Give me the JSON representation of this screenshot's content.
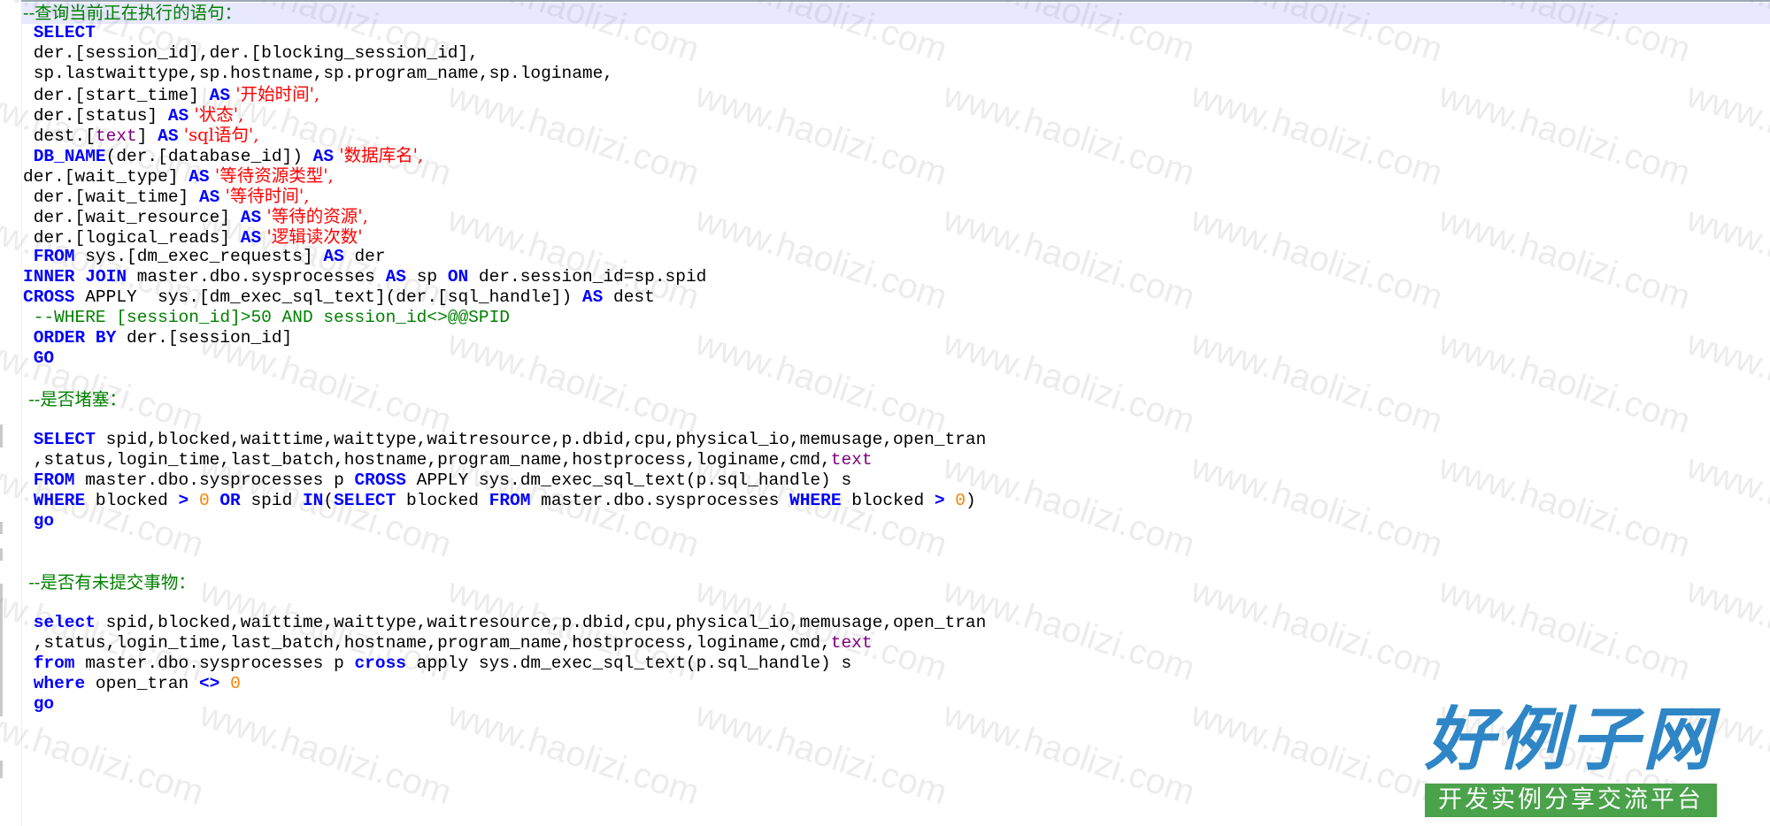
{
  "editor": {
    "lines": [
      {
        "tokens": [
          {
            "t": "--查询当前正在执行的语句：",
            "c": "cm"
          }
        ]
      },
      {
        "tokens": [
          {
            "t": " SELECT",
            "c": "kw"
          }
        ]
      },
      {
        "tokens": [
          {
            "t": " der.[session_id],der.[blocking_session_id],",
            "c": "id"
          }
        ]
      },
      {
        "tokens": [
          {
            "t": " sp.lastwaittype,sp.hostname,sp.program_name,sp.loginame,",
            "c": "id"
          }
        ]
      },
      {
        "tokens": [
          {
            "t": " der.[start_time] ",
            "c": "id"
          },
          {
            "t": "AS",
            "c": "kw"
          },
          {
            "t": " '开始时间',",
            "c": "st"
          }
        ]
      },
      {
        "tokens": [
          {
            "t": " der.[status] ",
            "c": "id"
          },
          {
            "t": "AS",
            "c": "kw"
          },
          {
            "t": " '状态',",
            "c": "st"
          }
        ]
      },
      {
        "tokens": [
          {
            "t": " dest.[",
            "c": "id"
          },
          {
            "t": "text",
            "c": "ob"
          },
          {
            "t": "] ",
            "c": "id"
          },
          {
            "t": "AS",
            "c": "kw"
          },
          {
            "t": " 'sql语句',",
            "c": "st"
          }
        ]
      },
      {
        "tokens": [
          {
            "t": " DB_NAME",
            "c": "fn"
          },
          {
            "t": "(der.[database_id]) ",
            "c": "id"
          },
          {
            "t": "AS",
            "c": "kw"
          },
          {
            "t": " '数据库名',",
            "c": "st"
          }
        ]
      },
      {
        "tokens": [
          {
            "t": "der.[wait_type] ",
            "c": "id"
          },
          {
            "t": "AS",
            "c": "kw"
          },
          {
            "t": " '等待资源类型',",
            "c": "st"
          }
        ]
      },
      {
        "tokens": [
          {
            "t": " der.[wait_time] ",
            "c": "id"
          },
          {
            "t": "AS",
            "c": "kw"
          },
          {
            "t": " '等待时间',",
            "c": "st"
          }
        ]
      },
      {
        "tokens": [
          {
            "t": " der.[wait_resource] ",
            "c": "id"
          },
          {
            "t": "AS",
            "c": "kw"
          },
          {
            "t": " '等待的资源',",
            "c": "st"
          }
        ]
      },
      {
        "tokens": [
          {
            "t": " der.[logical_reads] ",
            "c": "id"
          },
          {
            "t": "AS",
            "c": "kw"
          },
          {
            "t": " '逻辑读次数'",
            "c": "st"
          }
        ]
      },
      {
        "tokens": [
          {
            "t": " FROM",
            "c": "kw"
          },
          {
            "t": " sys.[dm_exec_requests] ",
            "c": "id"
          },
          {
            "t": "AS",
            "c": "kw"
          },
          {
            "t": " der",
            "c": "id"
          }
        ]
      },
      {
        "tokens": [
          {
            "t": "INNER JOIN",
            "c": "kw"
          },
          {
            "t": " master.dbo.sysprocesses ",
            "c": "id"
          },
          {
            "t": "AS",
            "c": "kw"
          },
          {
            "t": " sp ",
            "c": "id"
          },
          {
            "t": "ON",
            "c": "kw"
          },
          {
            "t": " der.session_id=sp.spid",
            "c": "id"
          }
        ]
      },
      {
        "tokens": [
          {
            "t": "CROSS",
            "c": "kw"
          },
          {
            "t": " APPLY  sys.[dm_exec_sql_text](der.[sql_handle]) ",
            "c": "id"
          },
          {
            "t": "AS",
            "c": "kw"
          },
          {
            "t": " dest",
            "c": "id"
          }
        ]
      },
      {
        "tokens": [
          {
            "t": " --WHERE [session_id]>50 AND session_id<>@@SPID",
            "c": "cm"
          }
        ]
      },
      {
        "tokens": [
          {
            "t": " ORDER BY",
            "c": "kw"
          },
          {
            "t": " der.[session_id]",
            "c": "id"
          }
        ]
      },
      {
        "tokens": [
          {
            "t": " GO",
            "c": "kw"
          }
        ]
      },
      {
        "tokens": []
      },
      {
        "tokens": [
          {
            "t": " --是否堵塞：",
            "c": "cm"
          }
        ]
      },
      {
        "tokens": []
      },
      {
        "tokens": [
          {
            "t": " SELECT",
            "c": "kw"
          },
          {
            "t": " spid,blocked,waittime,waittype,waitresource,p.dbid,cpu,physical_io,memusage,open_tran",
            "c": "id"
          }
        ]
      },
      {
        "tokens": [
          {
            "t": " ,status,login_time,last_batch,hostname,program_name,hostprocess,loginame,cmd,",
            "c": "id"
          },
          {
            "t": "text",
            "c": "ob"
          }
        ]
      },
      {
        "tokens": [
          {
            "t": " FROM",
            "c": "kw"
          },
          {
            "t": " master.dbo.sysprocesses p ",
            "c": "id"
          },
          {
            "t": "CROSS",
            "c": "kw"
          },
          {
            "t": " APPLY sys.dm_exec_sql_text(p.sql_handle) s",
            "c": "id"
          }
        ]
      },
      {
        "tokens": [
          {
            "t": " WHERE",
            "c": "kw"
          },
          {
            "t": " blocked ",
            "c": "id"
          },
          {
            "t": ">",
            "c": "kw"
          },
          {
            "t": " ",
            "c": "id"
          },
          {
            "t": "0",
            "c": "num"
          },
          {
            "t": " ",
            "c": "id"
          },
          {
            "t": "OR",
            "c": "kw"
          },
          {
            "t": " spid ",
            "c": "id"
          },
          {
            "t": "IN",
            "c": "kw"
          },
          {
            "t": "(",
            "c": "id"
          },
          {
            "t": "SELECT",
            "c": "kw"
          },
          {
            "t": " blocked ",
            "c": "id"
          },
          {
            "t": "FROM",
            "c": "kw"
          },
          {
            "t": " master.dbo.sysprocesses ",
            "c": "id"
          },
          {
            "t": "WHERE",
            "c": "kw"
          },
          {
            "t": " blocked ",
            "c": "id"
          },
          {
            "t": ">",
            "c": "kw"
          },
          {
            "t": " ",
            "c": "id"
          },
          {
            "t": "0",
            "c": "num"
          },
          {
            "t": ")",
            "c": "id"
          }
        ]
      },
      {
        "tokens": [
          {
            "t": " go",
            "c": "kw"
          }
        ]
      },
      {
        "tokens": []
      },
      {
        "tokens": []
      },
      {
        "tokens": [
          {
            "t": " --是否有未提交事物：",
            "c": "cm"
          }
        ]
      },
      {
        "tokens": []
      },
      {
        "tokens": [
          {
            "t": " select",
            "c": "kw"
          },
          {
            "t": " spid,blocked,waittime,waittype,waitresource,p.dbid,cpu,physical_io,memusage,open_tran",
            "c": "id"
          }
        ]
      },
      {
        "tokens": [
          {
            "t": " ,status,login_time,last_batch,hostname,program_name,hostprocess,loginame,cmd,",
            "c": "id"
          },
          {
            "t": "text",
            "c": "ob"
          }
        ]
      },
      {
        "tokens": [
          {
            "t": " from",
            "c": "kw"
          },
          {
            "t": " master.dbo.sysprocesses p ",
            "c": "id"
          },
          {
            "t": "cross",
            "c": "kw"
          },
          {
            "t": " apply sys.dm_exec_sql_text(p.sql_handle) s",
            "c": "id"
          }
        ]
      },
      {
        "tokens": [
          {
            "t": " where",
            "c": "kw"
          },
          {
            "t": " open_tran ",
            "c": "id"
          },
          {
            "t": "<>",
            "c": "kw"
          },
          {
            "t": " ",
            "c": "id"
          },
          {
            "t": "0",
            "c": "num"
          }
        ]
      },
      {
        "tokens": [
          {
            "t": " go",
            "c": "kw"
          }
        ]
      }
    ]
  },
  "watermark": {
    "text": "www.haolizi.com"
  },
  "logo": {
    "title": "好例子网",
    "subtitle": "开发实例分享交流平台"
  },
  "colors": {
    "keyword": "#0000ff",
    "comment": "#008000",
    "string": "#ff0000",
    "number": "#ff8000",
    "object": "#800080",
    "current_line": "#e8e8ff"
  }
}
